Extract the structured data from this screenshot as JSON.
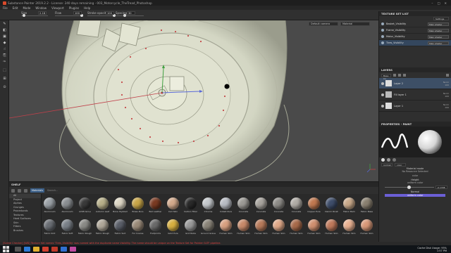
{
  "window": {
    "title": "Substance Painter 2019.2.2 - License: 240 days remaining - 003_Motorcycle_TheTread_Photoshop"
  },
  "menu": [
    "File",
    "Edit",
    "Mode",
    "Window",
    "Viewport",
    "Plugins",
    "Help"
  ],
  "toolbar": {
    "size_label": "Size",
    "size_value": "2.18",
    "flow_label": "Flow",
    "flow_value": "100",
    "stroke_opacity_label": "Stroke opacity",
    "stroke_opacity_value": "100",
    "spacing_label": "Spacing",
    "spacing_value": "30"
  },
  "viewport": {
    "camera_select": "Default camera",
    "channel_select": "Material"
  },
  "texture_set_list": {
    "title": "TEXTURE SET LIST",
    "settings_label": "Settings",
    "items": [
      {
        "name": "Basket_Visibility",
        "shader": "Main shader"
      },
      {
        "name": "Frame_Visibility",
        "shader": "Main shader"
      },
      {
        "name": "Motor_Visibility",
        "shader": "Main shader"
      },
      {
        "name": "Tires_Visibility",
        "shader": "Main shader"
      }
    ]
  },
  "layers": {
    "title": "LAYERS",
    "channel_select": "Base Co",
    "items": [
      {
        "name": "Layer 2",
        "blend": "Norm",
        "opacity": "100"
      },
      {
        "name": "Fill layer 1",
        "blend": "Norm",
        "opacity": "100"
      },
      {
        "name": "Layer 1",
        "blend": "Norm",
        "opacity": "100"
      }
    ]
  },
  "properties": {
    "title": "PROPERTIES - PAINT",
    "tab_label": "normal",
    "material_label": "color",
    "material_mode_title": "Material mode",
    "material_mode_value": "No Resource Selected",
    "color_value": "color",
    "height_title": "Height",
    "height_value": "uniform color",
    "height_number": "-0.1338",
    "normal_title": "Normal",
    "normal_value": "uniform color",
    "accent": "#6b5fd6"
  },
  "shelf": {
    "title": "SHELF",
    "filter_tag": "Materials",
    "search_placeholder": "Search...",
    "categories": [
      "All",
      "Project",
      "Alphas",
      "Grunges",
      "Procedurals",
      "Textures",
      "Hard Surfaces",
      "Skin",
      "Filters",
      "Brushes"
    ],
    "materials": [
      {
        "name": "Aluminium",
        "color": "#9aa0a6"
      },
      {
        "name": "Aluminium",
        "color": "#8a8e92"
      },
      {
        "name": "Artificial Le",
        "color": "#3a3a3a"
      },
      {
        "name": "Autumn Leaf",
        "color": "#b8b08a"
      },
      {
        "name": "Bone Stylized",
        "color": "#ddd6c4"
      },
      {
        "name": "Brass Pure",
        "color": "#c9a648"
      },
      {
        "name": "Bull Leather",
        "color": "#7a3a22"
      },
      {
        "name": "Carl Skin",
        "color": "#d3aa8c"
      },
      {
        "name": "Carbon Fiber",
        "color": "#2a2a2a"
      },
      {
        "name": "Chrome",
        "color": "#c4c8cc"
      },
      {
        "name": "Cobalt Pure",
        "color": "#b8bcc4"
      },
      {
        "name": "Concrete",
        "color": "#9c9a95"
      },
      {
        "name": "Concrete",
        "color": "#a8a49e"
      },
      {
        "name": "Concrete",
        "color": "#8e8c88"
      },
      {
        "name": "Concrete",
        "color": "#b0aca6"
      },
      {
        "name": "Copper Pure",
        "color": "#c07850"
      },
      {
        "name": "Denim Rivet",
        "color": "#3e4d6a"
      },
      {
        "name": "Fabric Bam",
        "color": "#c9a98a"
      },
      {
        "name": "Fabric Base",
        "color": "#8a8070"
      },
      {
        "name": "Fabric Knit",
        "color": "#6a6e74"
      },
      {
        "name": "Fabric Soft",
        "color": "#7a8088"
      },
      {
        "name": "Fabric Rough",
        "color": "#8a8a86"
      },
      {
        "name": "Fabric Rough",
        "color": "#b0a89a"
      },
      {
        "name": "Fabric Suit",
        "color": "#5a5e68"
      },
      {
        "name": "Fur Coarse",
        "color": "#9a8a78"
      },
      {
        "name": "Footprints",
        "color": "#6a6a6a"
      },
      {
        "name": "Gold Pure",
        "color": "#d8b040"
      },
      {
        "name": "Grid Nubs",
        "color": "#9a9a9a"
      },
      {
        "name": "Ground Gravel",
        "color": "#8a8478"
      },
      {
        "name": "Human Skin",
        "color": "#d8a080"
      },
      {
        "name": "Human Skin",
        "color": "#c88a6a"
      },
      {
        "name": "Human Skin",
        "color": "#b87a5a"
      },
      {
        "name": "Human Skin",
        "color": "#e0a888"
      },
      {
        "name": "Human Skin",
        "color": "#a86a4a"
      },
      {
        "name": "Human Skin",
        "color": "#d09070"
      },
      {
        "name": "Human Skin",
        "color": "#c07a5c"
      },
      {
        "name": "Human Skin",
        "color": "#e8b090"
      },
      {
        "name": "Human Skin",
        "color": "#d89878"
      }
    ]
  },
  "status": {
    "text": "[Scene Checker] [WD] Texture Set names 'Tires_Visibility' was named with the duplicate name Visibility. The name should be unique on the Texture Set for Painter GLTF pipeline."
  },
  "tray": {
    "line1": "Cache Disk Usage: 95%",
    "line2": "1:57 PM"
  }
}
